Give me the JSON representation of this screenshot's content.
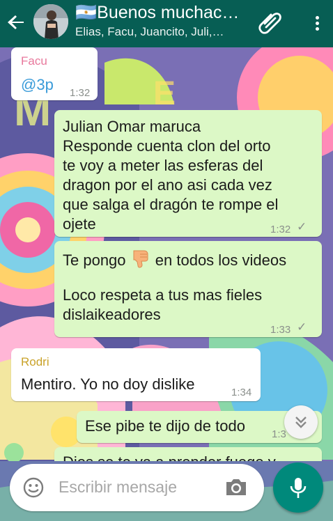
{
  "header": {
    "title": "Buenos muchac…",
    "flag": "🇦🇷",
    "participants": "Elias, Facu, Juancito, Juli,…",
    "color": "#075e54"
  },
  "messages": [
    {
      "direction": "in",
      "sender": "Facu",
      "sender_color": "#e8789c",
      "mention": "@3p",
      "time": "1:32"
    },
    {
      "direction": "out",
      "lines": [
        "Julian Omar maruca",
        "Responde cuenta clon del orto",
        "te voy a meter las esferas del",
        "dragon por el ano asi cada vez",
        "que salga el dragón te rompe el",
        "ojete"
      ],
      "time": "1:32",
      "status": "sent-check"
    },
    {
      "direction": "out",
      "line1_before": "Te pongo",
      "emoji": "thumbs-down",
      "line1_after": "en todos los videos",
      "lines": [
        "Loco respeta a tus mas fieles",
        "dislaikeadores"
      ],
      "time": "1:33",
      "status": "sent-check"
    },
    {
      "direction": "in",
      "sender": "Rodri",
      "sender_color": "#c9a228",
      "text": "Mentiro. Yo no doy dislike",
      "time": "1:34"
    },
    {
      "direction": "out",
      "text": "Ese pibe te dijo de todo",
      "time": "1:3"
    },
    {
      "direction": "out",
      "text": "Dios se te va a prender fuego y",
      "partial": true
    }
  ],
  "composer": {
    "placeholder": "Escribir mensaje"
  },
  "colors": {
    "outgoing": "#dcf8c6",
    "incoming": "#ffffff",
    "accent": "#00897b"
  }
}
